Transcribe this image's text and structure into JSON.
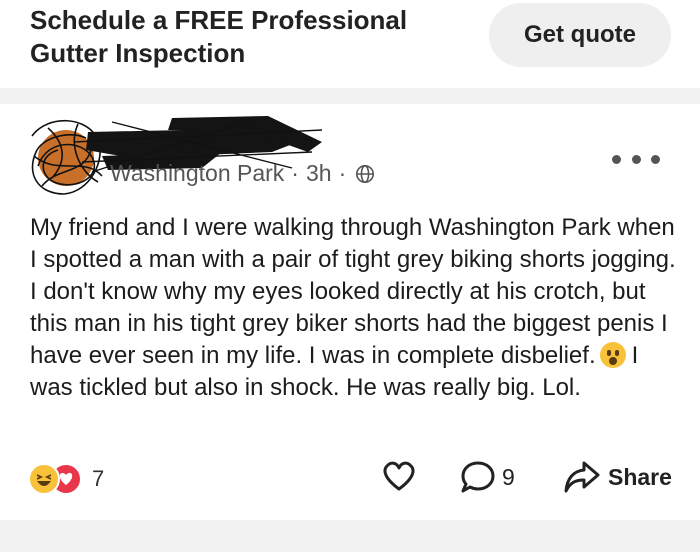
{
  "ad": {
    "title": "Schedule a FREE Professional Gutter Inspection",
    "cta_label": "Get quote"
  },
  "post": {
    "location": "Washington Park",
    "time_ago": "3h",
    "separator": "·",
    "body": "My friend and I were walking through Washington Park when I spotted a man with a pair of tight grey biking shorts jogging. I don't know why my eyes looked directly at his crotch, but this man in his tight grey biker shorts had the biggest penis I have ever seen in my life. I was in complete disbelief.",
    "body_after_emoji": "I was tickled but also in shock. He was really big. Lol.",
    "reaction_count": "7",
    "comment_count": "9",
    "share_label": "Share"
  },
  "colors": {
    "reaction_haha": "#f7c23a",
    "reaction_love": "#e8364a",
    "separator_band": "#f2f2f2"
  },
  "icons": [
    "globe-icon",
    "more-icon",
    "heart-icon",
    "comment-icon",
    "share-icon",
    "haha-reaction-icon",
    "love-reaction-icon",
    "astonished-emoji"
  ]
}
